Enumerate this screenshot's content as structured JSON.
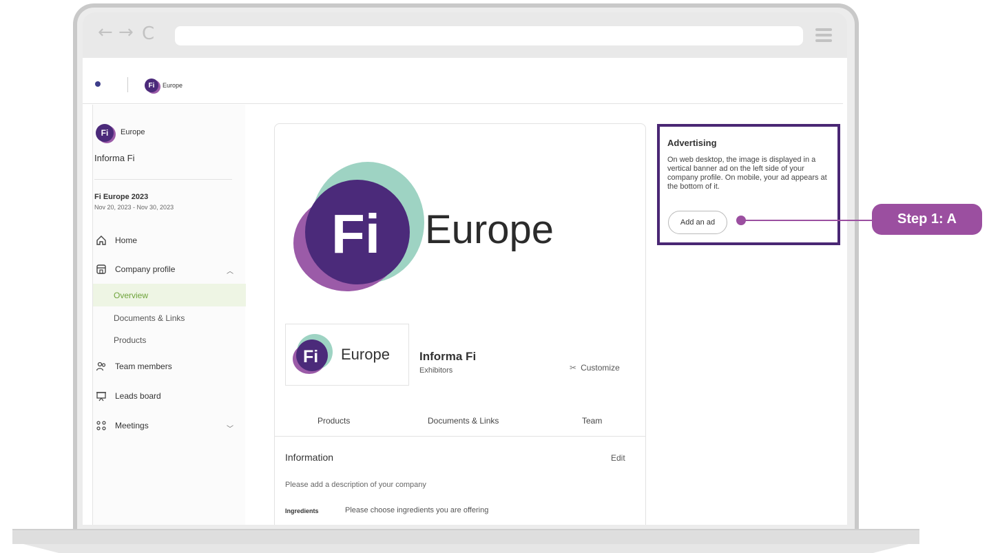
{
  "topbar": {
    "brand_small": "Europe"
  },
  "sidebar": {
    "exhibitor_label": "Europe",
    "company_name": "Informa Fi",
    "event_name": "Fi Europe 2023",
    "event_dates": "Nov 20, 2023 - Nov 30, 2023",
    "items": [
      {
        "label": "Home",
        "icon": "home-icon"
      },
      {
        "label": "Company profile",
        "icon": "store-icon"
      },
      {
        "label": "Team members",
        "icon": "users-icon"
      },
      {
        "label": "Leads board",
        "icon": "presentation-icon"
      },
      {
        "label": "Meetings",
        "icon": "meeting-icon"
      }
    ],
    "sub_items": [
      "Overview",
      "Documents & Links",
      "Products"
    ]
  },
  "main": {
    "hero_text": "Europe",
    "logo_small_text": "Europe",
    "company_name": "Informa Fi",
    "company_type": "Exhibitors",
    "customize_label": "Customize",
    "tabs": [
      "Products",
      "Documents & Links",
      "Team"
    ],
    "information": {
      "title": "Information",
      "edit_label": "Edit",
      "description": "Please add a description of your company",
      "ingredients_label": "Ingredients",
      "ingredients_value": "Please choose ingredients you are offering"
    }
  },
  "advertising": {
    "title": "Advertising",
    "description": "On web desktop, the image is displayed in a vertical banner ad on the left side of your company profile. On mobile, your ad appears at the bottom of it.",
    "button_label": "Add an ad"
  },
  "callout": {
    "label": "Step 1: A"
  },
  "colors": {
    "brand_purple": "#4b2a7a",
    "accent_pink": "#9b4fa0",
    "active_green": "#6ea33a"
  }
}
